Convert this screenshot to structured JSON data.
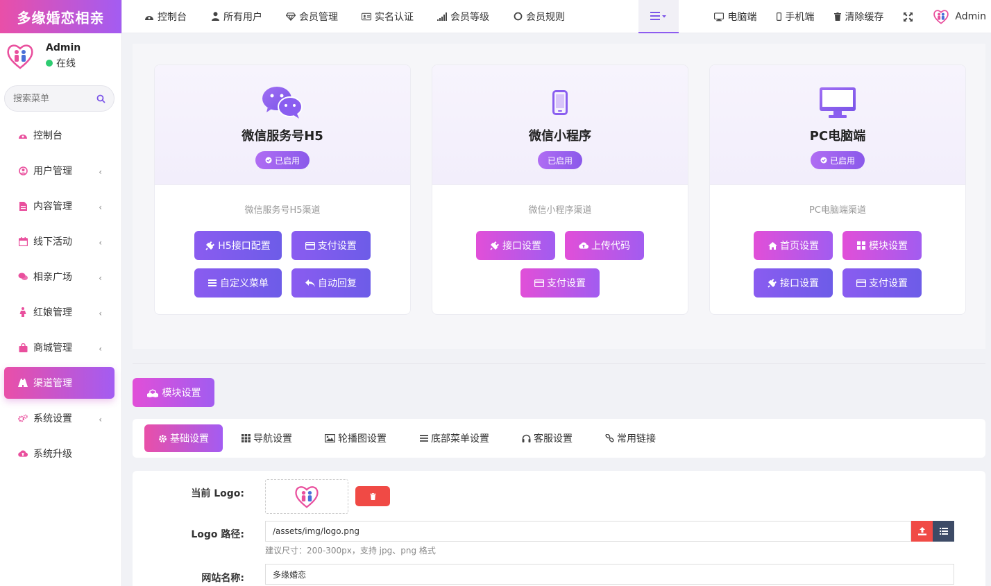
{
  "app": {
    "brand": "多缘婚恋相亲"
  },
  "user": {
    "name": "Admin",
    "status": "在线"
  },
  "search": {
    "placeholder": "搜索菜单"
  },
  "sidebar": {
    "items": [
      {
        "label": "控制台"
      },
      {
        "label": "用户管理"
      },
      {
        "label": "内容管理"
      },
      {
        "label": "线下活动"
      },
      {
        "label": "相亲广场"
      },
      {
        "label": "红娘管理"
      },
      {
        "label": "商城管理"
      },
      {
        "label": "渠道管理"
      },
      {
        "label": "系统设置"
      },
      {
        "label": "系统升级"
      }
    ],
    "chevron": "‹"
  },
  "topnav": {
    "items": [
      {
        "label": "控制台"
      },
      {
        "label": "所有用户"
      },
      {
        "label": "会员管理"
      },
      {
        "label": "实名认证"
      },
      {
        "label": "会员等级"
      },
      {
        "label": "会员规则"
      }
    ],
    "right": [
      {
        "label": "电脑端"
      },
      {
        "label": "手机端"
      },
      {
        "label": "清除缓存"
      }
    ],
    "admin": "Admin"
  },
  "channels": [
    {
      "title": "微信服务号H5",
      "badge": "已启用",
      "desc": "微信服务号H5渠道",
      "buttons": [
        "H5接口配置",
        "支付设置",
        "自定义菜单",
        "自动回复"
      ]
    },
    {
      "title": "微信小程序",
      "badge": "已启用",
      "desc": "微信小程序渠道",
      "buttons": [
        "接口设置",
        "上传代码",
        "支付设置"
      ]
    },
    {
      "title": "PC电脑端",
      "badge": "已启用",
      "desc": "PC电脑端渠道",
      "buttons": [
        "首页设置",
        "模块设置",
        "接口设置",
        "支付设置"
      ]
    }
  ],
  "module_button": "模块设置",
  "tabs": [
    "基础设置",
    "导航设置",
    "轮播图设置",
    "底部菜单设置",
    "客服设置",
    "常用链接"
  ],
  "form": {
    "logo_label": "当前 Logo:",
    "logo_path_label": "Logo 路径:",
    "logo_path_value": "/assets/img/logo.png",
    "logo_hint": "建议尺寸：200-300px，支持 jpg、png 格式",
    "site_name_label": "网站名称:",
    "site_name_value": "多缘婚恋"
  },
  "colors": {
    "accent_pink": "#e94fa8",
    "accent_purple": "#a35cf2",
    "danger": "#f04a45",
    "online": "#2ecc71"
  }
}
